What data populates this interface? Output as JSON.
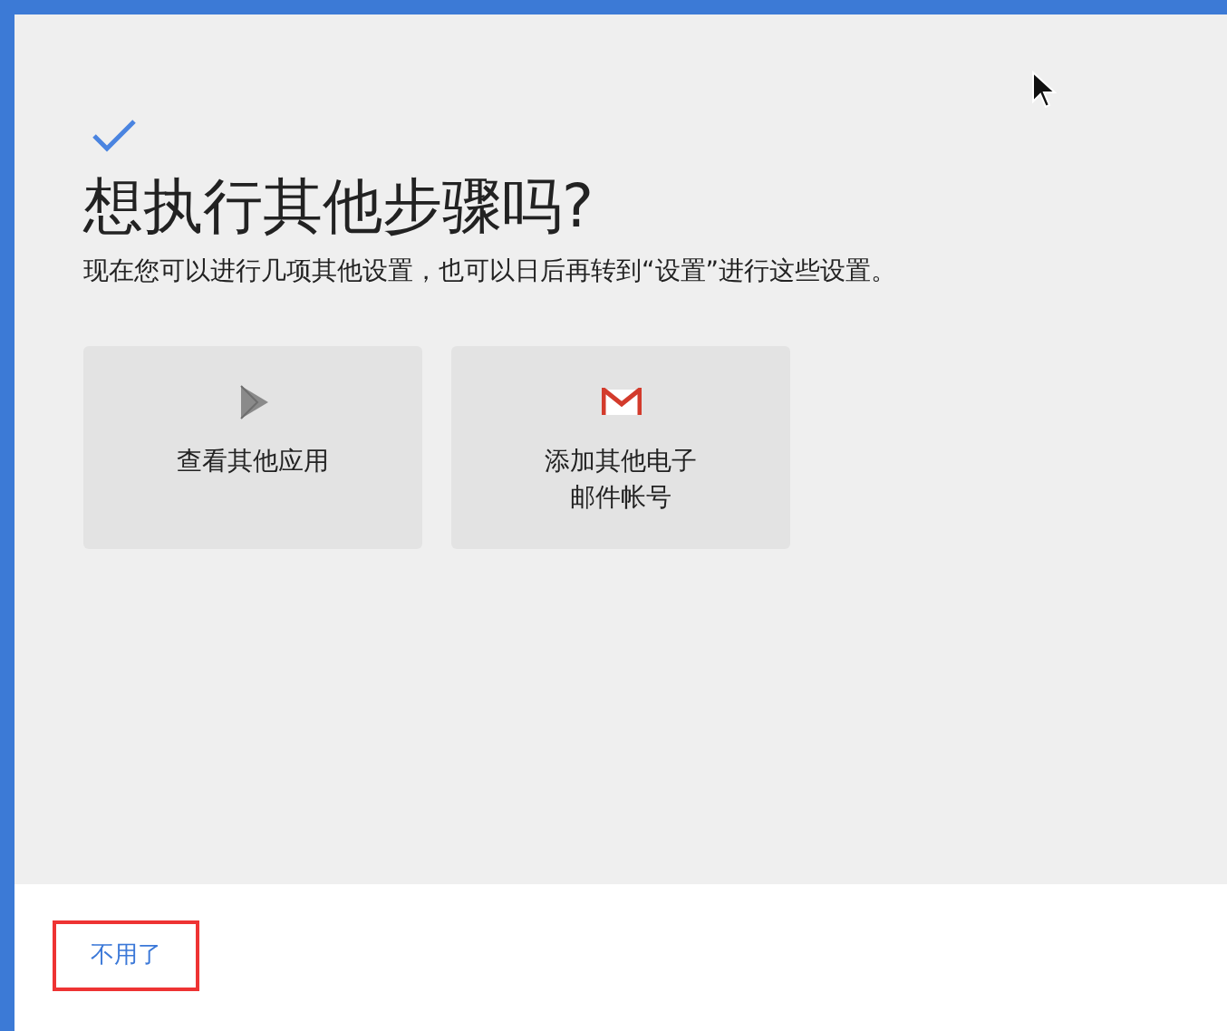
{
  "title": "想执行其他步骤吗?",
  "subtitle": "现在您可以进行几项其他设置，也可以日后再转到“设置”进行这些设置。",
  "options": [
    {
      "kind": "play",
      "lines": [
        "查看其他应用"
      ]
    },
    {
      "kind": "mail",
      "lines": [
        "添加其他电子",
        "邮件帐号"
      ]
    }
  ],
  "skip_button": {
    "label": "不用了",
    "highlighted": true
  }
}
